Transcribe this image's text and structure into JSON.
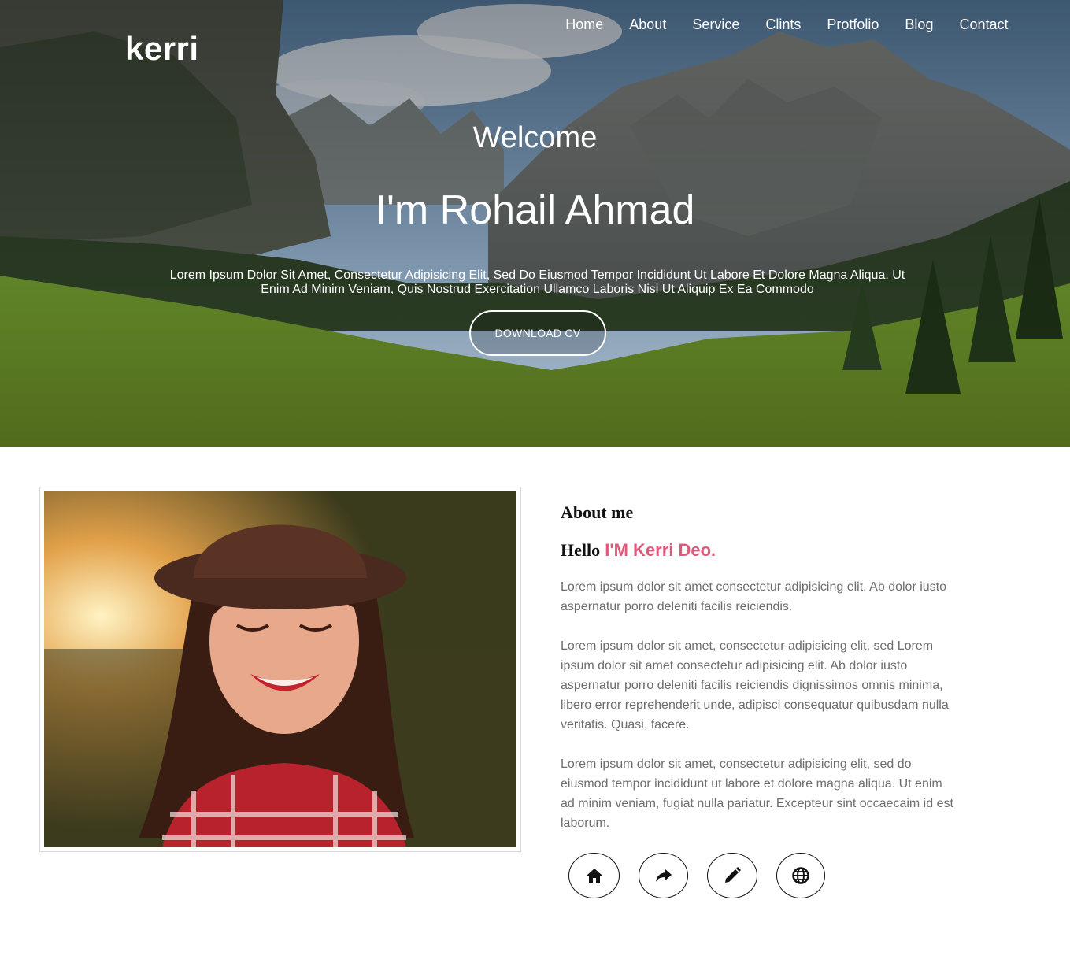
{
  "header": {
    "brand": "kerri",
    "nav": [
      "Home",
      "About",
      "Service",
      "Clints",
      "Protfolio",
      "Blog",
      "Contact"
    ]
  },
  "hero": {
    "welcome": "Welcome",
    "headline": "I'm Rohail Ahmad",
    "intro": "Lorem Ipsum Dolor Sit Amet, Consectetur Adipisicing Elit, Sed Do Eiusmod Tempor Incididunt Ut Labore Et Dolore Magna Aliqua. Ut Enim Ad Minim Veniam, Quis Nostrud Exercitation Ullamco Laboris Nisi Ut Aliquip Ex Ea Commodo",
    "cta_label": "DOWNLOAD CV"
  },
  "about": {
    "title": "About me",
    "hello_prefix": "Hello",
    "hello_name": "I'M Kerri Deo.",
    "paragraphs": [
      "Lorem ipsum dolor sit amet consectetur adipisicing elit. Ab dolor iusto aspernatur porro deleniti facilis reiciendis.",
      "Lorem ipsum dolor sit amet, consectetur adipisicing elit, sed Lorem ipsum dolor sit amet consectetur adipisicing elit. Ab dolor iusto aspernatur porro deleniti facilis reiciendis dignissimos omnis minima, libero error reprehenderit unde, adipisci consequatur quibusdam nulla veritatis. Quasi, facere.",
      "Lorem ipsum dolor sit amet, consectetur adipisicing elit, sed do eiusmod tempor incididunt ut labore et dolore magna aliqua. Ut enim ad minim veniam, fugiat nulla pariatur. Excepteur sint occaecaim id est laborum."
    ],
    "social_icons": [
      "home-icon",
      "share-icon",
      "pencil-icon",
      "globe-icon"
    ]
  },
  "colors": {
    "accent": "#e0587a",
    "body_text": "#6d6d6d",
    "heading": "#111111"
  }
}
